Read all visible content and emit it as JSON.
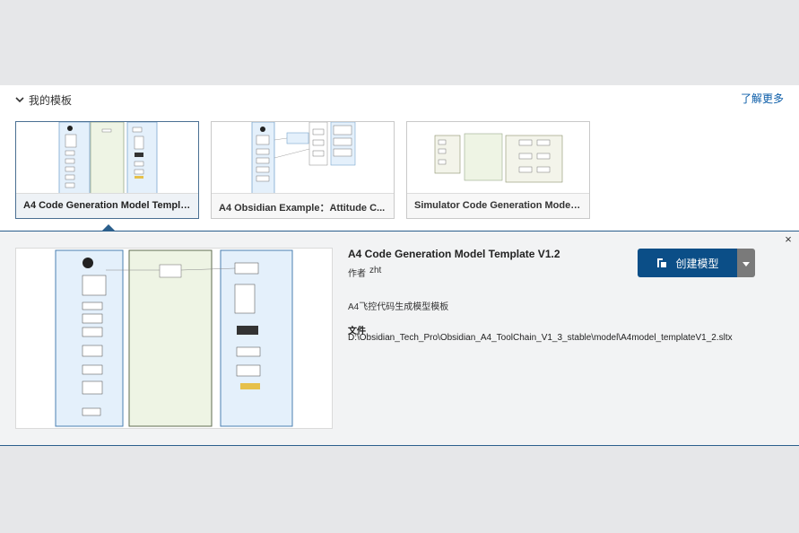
{
  "section": {
    "title": "我的模板",
    "learn_more": "了解更多"
  },
  "cards": [
    {
      "label": "A4 Code Generation Model Templa...",
      "selected": true
    },
    {
      "label": "A4 Obsidian Example：Attitude C...",
      "selected": false
    },
    {
      "label": "Simulator Code Generation Model ...",
      "selected": false
    }
  ],
  "details": {
    "title": "A4 Code Generation Model Template V1.2",
    "author_prefix": "作者",
    "author": "zht",
    "description": "A4飞控代码生成模型模板",
    "file_label": "文件",
    "file_path": "D:\\Obsidian_Tech_Pro\\Obsidian_A4_ToolChain_V1_3_stable\\model\\A4model_templateV1_2.sltx",
    "close_symbol": "×"
  },
  "actions": {
    "create_label": "创建模型"
  },
  "colors": {
    "accent": "#0b4e87",
    "link": "#0a5ca8",
    "selected_border": "#4a6f92",
    "dropdown": "#7a7a7a"
  },
  "icons": [
    "chevron-down-icon",
    "close-icon",
    "create-model-icon",
    "caret-down-icon"
  ]
}
